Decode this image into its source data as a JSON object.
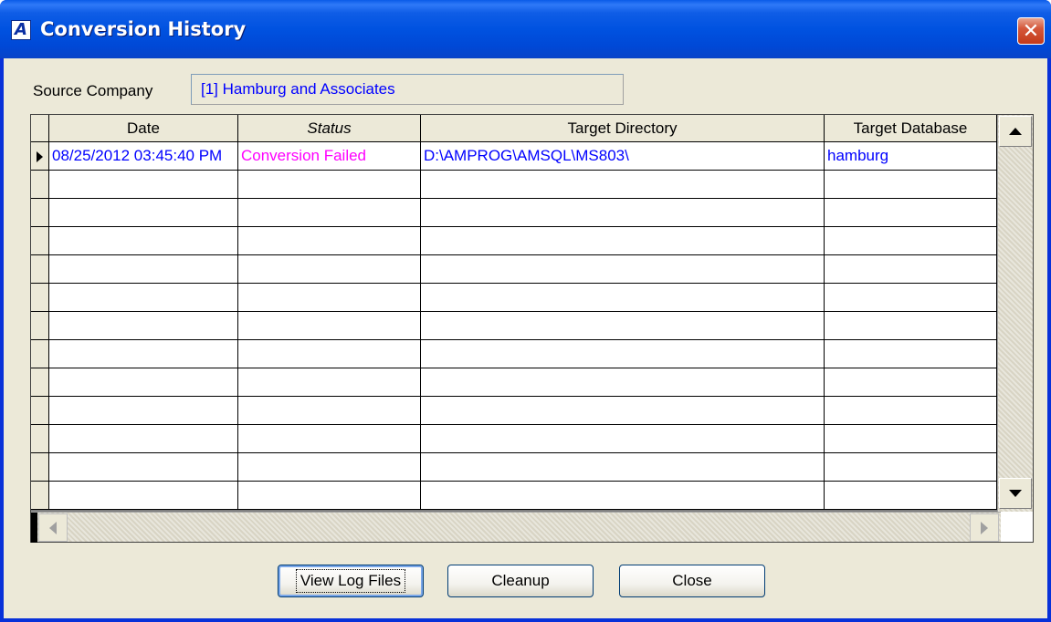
{
  "window": {
    "title": "Conversion History",
    "app_icon_letter": "A",
    "close_glyph": "✕"
  },
  "source": {
    "label": "Source Company",
    "value": "[1] Hamburg and Associates"
  },
  "grid": {
    "columns": [
      "Date",
      "Status",
      "Target Directory",
      "Target Database"
    ],
    "rows": [
      {
        "date": "08/25/2012 03:45:40 PM",
        "status": "Conversion Failed",
        "directory": "D:\\AMPROG\\AMSQL\\MS803\\",
        "database": "hamburg"
      }
    ],
    "empty_row_count": 12
  },
  "buttons": {
    "view_log": "View Log Files",
    "cleanup": "Cleanup",
    "close": "Close"
  },
  "colors": {
    "title_bar": "#0052e0",
    "value_text": "#0000ff",
    "status_failed": "#ff00ff",
    "dialog_bg": "#ece9d8"
  }
}
